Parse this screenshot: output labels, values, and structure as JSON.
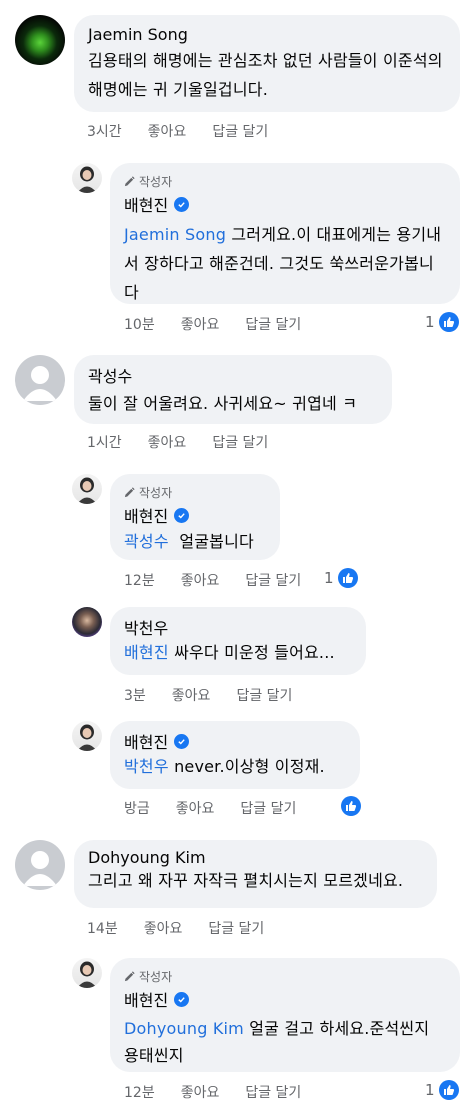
{
  "author_badge": "작성자",
  "like_label": "좋아요",
  "reply_label": "답글 달기",
  "comments": [
    {
      "name": "Jaemin Song",
      "text": "김용태의 해명에는 관심조차 없던 사람들이 이준석의 해명에는 귀 기울일겁니다.",
      "time": "3시간"
    },
    {
      "name": "배현진",
      "mention": "Jaemin Song",
      "text": "그러게요.이 대표에게는 용기내서 장하다고 해준건데. 그것도 쑥쓰러운가봅니다",
      "time": "10분",
      "likes": "1"
    },
    {
      "name": "곽성수",
      "text": "둘이 잘 어울려요. 사귀세요~ 귀엽네 ㅋ",
      "time": "1시간"
    },
    {
      "name": "배현진",
      "mention": "곽성수",
      "text": "얼굴봅니다",
      "time": "12분",
      "likes": "1"
    },
    {
      "name": "박천우",
      "mention": "배현진",
      "text": "싸우다 미운정 들어요...",
      "time": "3분"
    },
    {
      "name": "배현진",
      "mention": "박천우",
      "text": "never.이상형 이정재.",
      "time": "방금"
    },
    {
      "name": "Dohyoung Kim",
      "text": "그리고 왜 자꾸 자작극 펼치시는지 모르겠네요.",
      "time": "14분"
    },
    {
      "name": "배현진",
      "mention": "Dohyoung Kim",
      "text": "얼굴 걸고 하세요.준석씬지 용태씬지",
      "time": "12분",
      "likes": "1"
    }
  ]
}
